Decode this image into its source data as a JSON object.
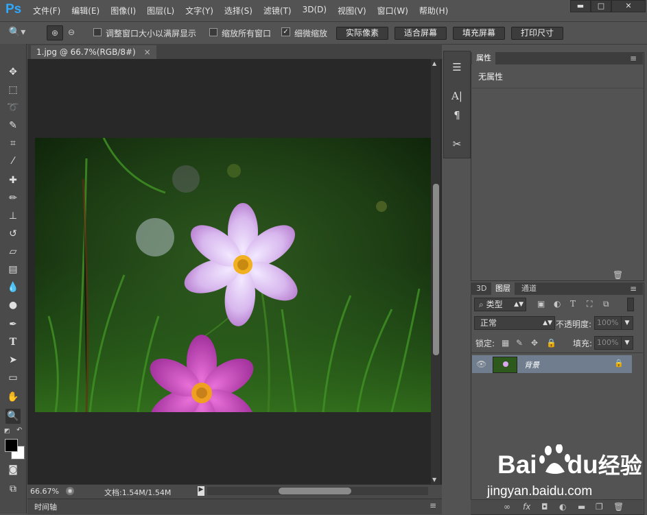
{
  "app": {
    "logo": "Ps"
  },
  "menu": [
    "文件(F)",
    "编辑(E)",
    "图像(I)",
    "图层(L)",
    "文字(Y)",
    "选择(S)",
    "滤镜(T)",
    "3D(D)",
    "视图(V)",
    "窗口(W)",
    "帮助(H)"
  ],
  "options": {
    "resize_windows_label": "调整窗口大小以满屏显示",
    "zoom_all_label": "缩放所有窗口",
    "scrubby_zoom_label": "细微缩放",
    "actual_pixels": "实际像素",
    "fit_screen": "适合屏幕",
    "fill_screen": "填充屏幕",
    "print_size": "打印尺寸"
  },
  "document": {
    "tab_title": "1.jpg @ 66.7%(RGB/8#)",
    "zoom": "66.67%",
    "doc_info": "文档:1.54M/1.54M",
    "timeline_label": "时间轴"
  },
  "properties": {
    "tab": "属性",
    "content": "无属性"
  },
  "layers": {
    "tabs": [
      "3D",
      "图层",
      "通道"
    ],
    "filter_kind": "类型",
    "blend_mode": "正常",
    "opacity_label": "不透明度:",
    "opacity_value": "100%",
    "lock_label": "锁定:",
    "fill_label": "填充:",
    "fill_value": "100%",
    "layer_name": "背景"
  },
  "watermark": {
    "brand": "Bai",
    "brand2": "du",
    "cn": "经验",
    "url": "jingyan.baidu.com"
  }
}
